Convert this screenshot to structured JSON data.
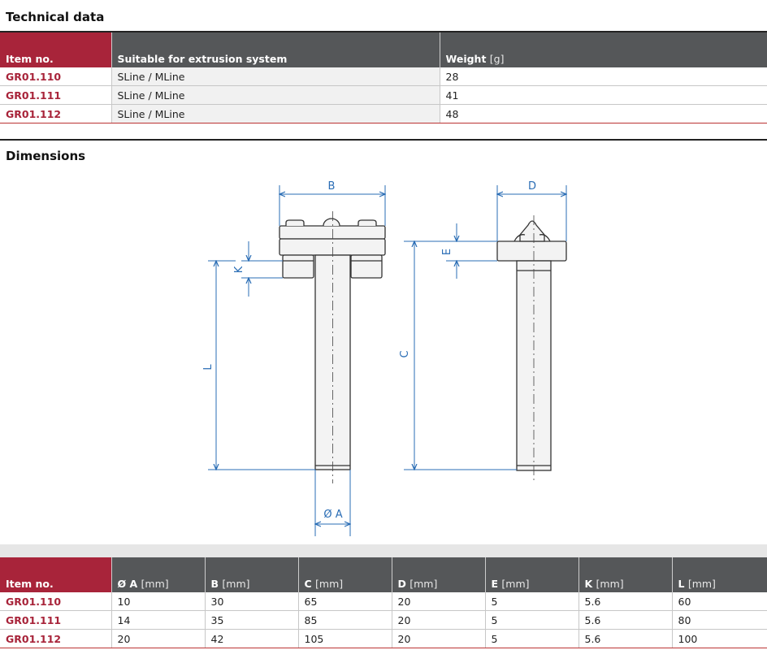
{
  "technical": {
    "title": "Technical data",
    "headers": {
      "item": "Item no.",
      "system": "Suitable for extrusion system",
      "weight": "Weight",
      "weight_unit": "[g]"
    },
    "rows": [
      {
        "item": "GR01.110",
        "system": "SLine / MLine",
        "weight": "28"
      },
      {
        "item": "GR01.111",
        "system": "SLine / MLine",
        "weight": "41"
      },
      {
        "item": "GR01.112",
        "system": "SLine / MLine",
        "weight": "48"
      }
    ]
  },
  "dimensions": {
    "title": "Dimensions",
    "labels": {
      "B": "B",
      "K": "K",
      "L": "L",
      "A": "Ø A",
      "D": "D",
      "E": "E",
      "C": "C"
    },
    "headers": {
      "item": "Item no.",
      "a": "Ø A",
      "b": "B",
      "c": "C",
      "d": "D",
      "e": "E",
      "k": "K",
      "l": "L",
      "unit": "[mm]"
    },
    "rows": [
      {
        "item": "GR01.110",
        "a": "10",
        "b": "30",
        "c": "65",
        "d": "20",
        "e": "5",
        "k": "5.6",
        "l": "60"
      },
      {
        "item": "GR01.111",
        "a": "14",
        "b": "35",
        "c": "85",
        "d": "20",
        "e": "5",
        "k": "5.6",
        "l": "80"
      },
      {
        "item": "GR01.112",
        "a": "20",
        "b": "42",
        "c": "105",
        "d": "20",
        "e": "5",
        "k": "5.6",
        "l": "100"
      }
    ]
  },
  "colors": {
    "accent": "#a8243a",
    "header_grey": "#555759",
    "dimension_blue": "#2a6db5"
  }
}
